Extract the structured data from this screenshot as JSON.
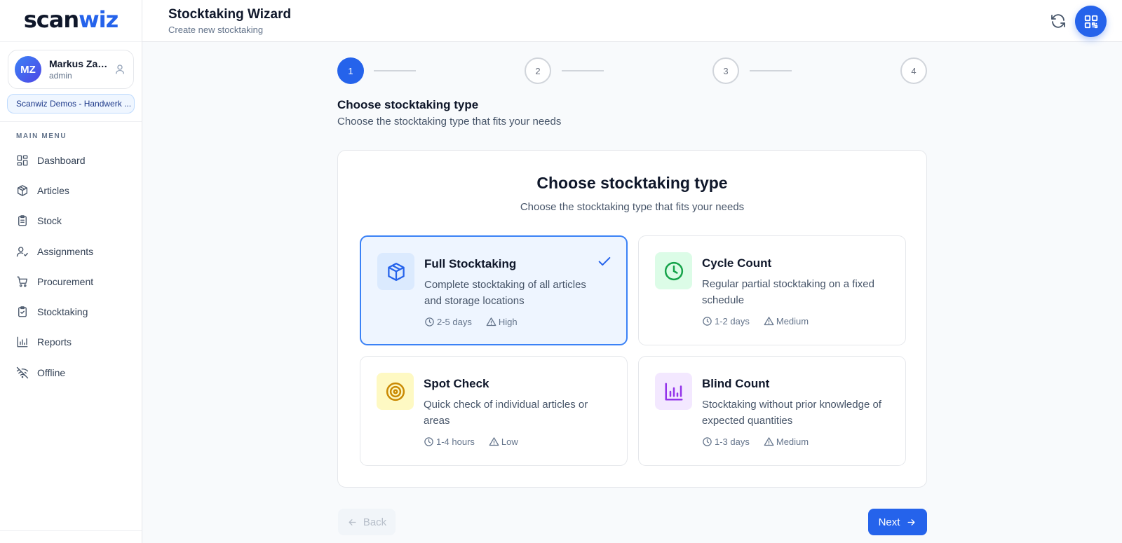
{
  "app": {
    "logo_part1": "scan",
    "logo_part2": "wiz"
  },
  "user": {
    "initials": "MZ",
    "name": "Markus Zau...",
    "role": "admin",
    "organization": "Scanwiz Demos - Handwerk ..."
  },
  "sidebar": {
    "menu_label": "MAIN MENU",
    "items": [
      {
        "label": "Dashboard",
        "icon": "dashboard-icon"
      },
      {
        "label": "Articles",
        "icon": "box-icon"
      },
      {
        "label": "Stock",
        "icon": "clipboard-list-icon"
      },
      {
        "label": "Assignments",
        "icon": "user-check-icon"
      },
      {
        "label": "Procurement",
        "icon": "cart-icon"
      },
      {
        "label": "Stocktaking",
        "icon": "clipboard-check-icon"
      },
      {
        "label": "Reports",
        "icon": "bar-chart-icon"
      },
      {
        "label": "Offline",
        "icon": "wifi-off-icon"
      }
    ]
  },
  "header": {
    "title": "Stocktaking Wizard",
    "subtitle": "Create new stocktaking"
  },
  "stepper": {
    "steps": [
      "1",
      "2",
      "3",
      "4"
    ],
    "active_step": 1
  },
  "section": {
    "title": "Choose stocktaking type",
    "subtitle": "Choose the stocktaking type that fits your needs"
  },
  "card": {
    "title": "Choose stocktaking type",
    "subtitle": "Choose the stocktaking type that fits your needs"
  },
  "options": [
    {
      "title": "Full Stocktaking",
      "description": "Complete stocktaking of all articles and storage locations",
      "duration": "2-5 days",
      "effort": "High",
      "selected": true,
      "icon": "box-icon",
      "icon_bg": "#dbeafe",
      "icon_color": "#2563eb"
    },
    {
      "title": "Cycle Count",
      "description": "Regular partial stocktaking on a fixed schedule",
      "duration": "1-2 days",
      "effort": "Medium",
      "selected": false,
      "icon": "clock-icon",
      "icon_bg": "#dcfce7",
      "icon_color": "#16a34a"
    },
    {
      "title": "Spot Check",
      "description": "Quick check of individual articles or areas",
      "duration": "1-4 hours",
      "effort": "Low",
      "selected": false,
      "icon": "target-icon",
      "icon_bg": "#fef9c3",
      "icon_color": "#ca8a04"
    },
    {
      "title": "Blind Count",
      "description": "Stocktaking without prior knowledge of expected quantities",
      "duration": "1-3 days",
      "effort": "Medium",
      "selected": false,
      "icon": "bar-chart-icon",
      "icon_bg": "#f3e8ff",
      "icon_color": "#9333ea"
    }
  ],
  "footer": {
    "back_label": "Back",
    "next_label": "Next"
  }
}
